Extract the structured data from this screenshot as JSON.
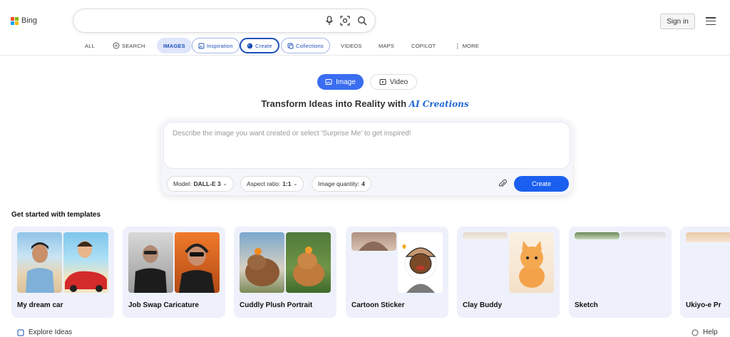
{
  "header": {
    "brand": "Bing",
    "brand_colors": [
      "#f25022",
      "#7fba00",
      "#00a4ef",
      "#ffb900"
    ],
    "search": {
      "value": "",
      "placeholder": ""
    },
    "signin_label": "Sign in"
  },
  "nav": {
    "all": "ALL",
    "search": "SEARCH",
    "images": "IMAGES",
    "inspiration": "Inspiration",
    "create": "Create",
    "collections": "Collections",
    "videos": "VIDEOS",
    "maps": "MAPS",
    "copilot": "COPILOT",
    "more": "MORE"
  },
  "toggle": {
    "image": "Image",
    "video": "Video"
  },
  "heading": {
    "main": "Transform Ideas into Reality with",
    "accent": "AI Creations"
  },
  "prompt": {
    "placeholder": "Describe the image you want created or select 'Surprise Me' to get inspired!",
    "model_label": "Model:",
    "model_value": "DALL-E 3",
    "aspect_label": "Aspect ratio:",
    "aspect_value": "1:1",
    "quantity_label": "Image quantity:",
    "quantity_value": "4",
    "create_label": "Create"
  },
  "templates": {
    "title": "Get started with templates",
    "cards": [
      {
        "label": "My dream car"
      },
      {
        "label": "Job Swap Caricature"
      },
      {
        "label": "Cuddly Plush Portrait"
      },
      {
        "label": "Cartoon Sticker"
      },
      {
        "label": "Clay Buddy"
      },
      {
        "label": "Sketch"
      },
      {
        "label": "Ukiyo-e Pr"
      }
    ]
  },
  "footer": {
    "explore": "Explore Ideas",
    "help": "Help"
  },
  "colors": {
    "accent": "#1a5ff0",
    "toggle_active": "#3a6df0",
    "card_bg": "#eef1fb"
  }
}
